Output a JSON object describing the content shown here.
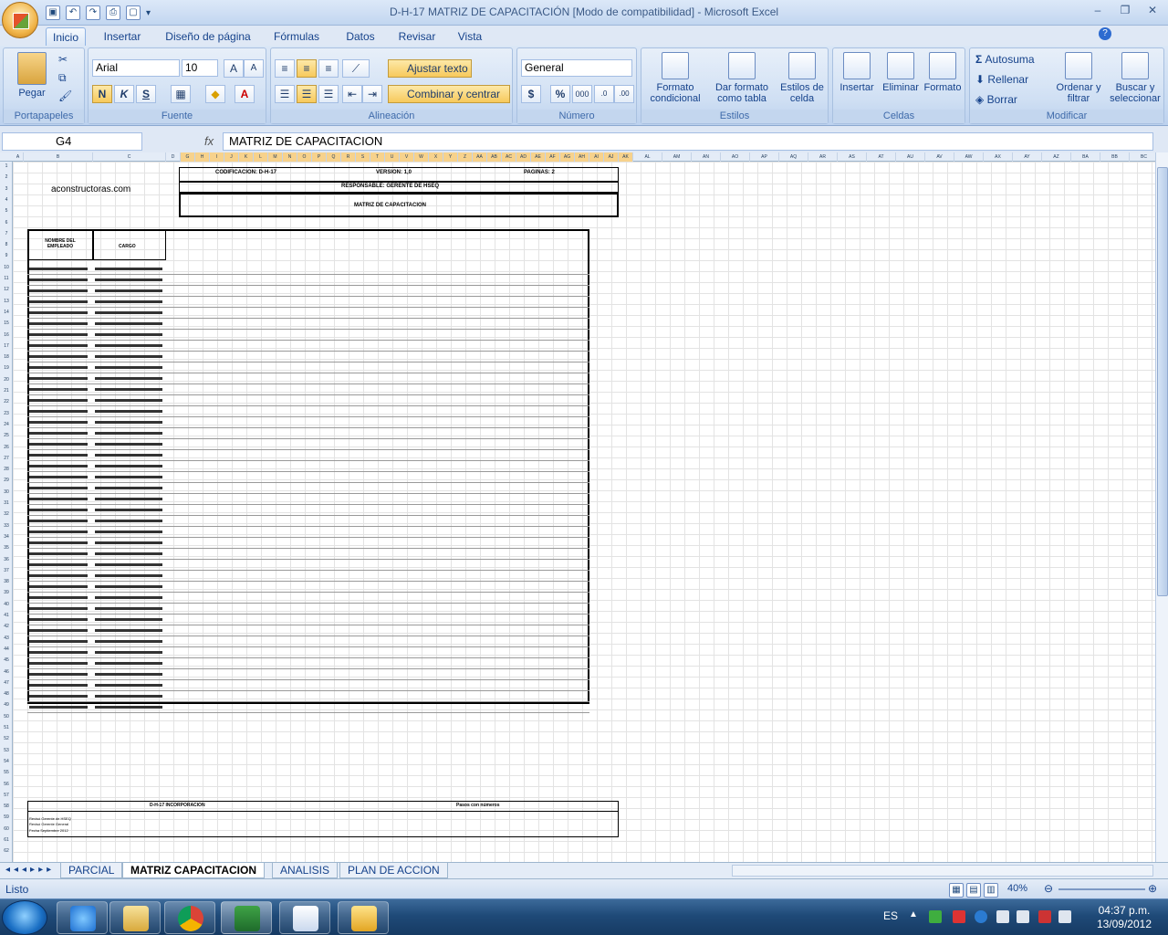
{
  "window": {
    "title": "D-H-17 MATRIZ DE CAPACITACIÓN  [Modo de compatibilidad] - Microsoft Excel"
  },
  "ribbon_tabs": [
    "Inicio",
    "Insertar",
    "Diseño de página",
    "Fórmulas",
    "Datos",
    "Revisar",
    "Vista"
  ],
  "clipboard": {
    "paste": "Pegar",
    "group": "Portapapeles"
  },
  "font": {
    "name": "Arial",
    "size": "10",
    "bold": "N",
    "italic": "K",
    "underline": "S",
    "group": "Fuente"
  },
  "alignment": {
    "wrap": "Ajustar texto",
    "merge": "Combinar y centrar",
    "group": "Alineación"
  },
  "number": {
    "format": "General",
    "currency": "$",
    "percent": "%",
    "thousands": "000",
    "group": "Número"
  },
  "styles": {
    "conditional": "Formato condicional",
    "table": "Dar formato como tabla",
    "cell": "Estilos de celda",
    "group": "Estilos"
  },
  "cells": {
    "insert": "Insertar",
    "delete": "Eliminar",
    "format": "Formato",
    "group": "Celdas"
  },
  "editing": {
    "autosum": "Autosuma",
    "fill": "Rellenar",
    "clear": "Borrar",
    "sort": "Ordenar y filtrar",
    "find": "Buscar y seleccionar",
    "group": "Modificar"
  },
  "formula_bar": {
    "name_box": "G4",
    "fx": "fx",
    "formula": "MATRIZ DE CAPACITACION"
  },
  "columns": [
    "A",
    "B",
    "C",
    "D",
    "G",
    "H",
    "I",
    "J",
    "K",
    "L",
    "M",
    "N",
    "O",
    "P",
    "Q",
    "R",
    "S",
    "T",
    "U",
    "V",
    "W",
    "X",
    "Y",
    "Z",
    "AA",
    "AB",
    "AC",
    "AD",
    "AE",
    "AF",
    "AG",
    "AH",
    "AI",
    "AJ",
    "AK",
    "AL",
    "AM",
    "AN",
    "AO",
    "AP",
    "AQ",
    "AR",
    "AS",
    "AT",
    "AU",
    "AV",
    "AW",
    "AX",
    "AY",
    "AZ",
    "BA",
    "BB",
    "BC"
  ],
  "sheet": {
    "logo": "aconstructoras.com",
    "codificacion": "CODIFICACION: D-H-17",
    "version": "VERSION: 1,0",
    "paginas": "PAGINAS: 2",
    "responsable": "RESPONSABLE: GERENTE DE HSEQ",
    "matriz": "MATRIZ DE CAPACITACION",
    "hdr_nombre": "NOMBRE DEL EMPLEADO",
    "hdr_cargo": "CARGO",
    "footer_left": "D-H-17 INCORPORACION",
    "footer_right": "Pasos con números",
    "footer_r1": "Revisó Gerente de HSEQ",
    "footer_r2": "Revisó Gerente General",
    "footer_r3": "Fecha Septiembre 2012"
  },
  "sheet_tabs": [
    "PARCIAL",
    "MATRIZ CAPACITACION",
    "ANALISIS",
    "PLAN DE ACCION"
  ],
  "status": {
    "ready": "Listo",
    "zoom": "40%"
  },
  "taskbar": {
    "lang": "ES",
    "time": "04:37 p.m.",
    "date": "13/09/2012"
  }
}
